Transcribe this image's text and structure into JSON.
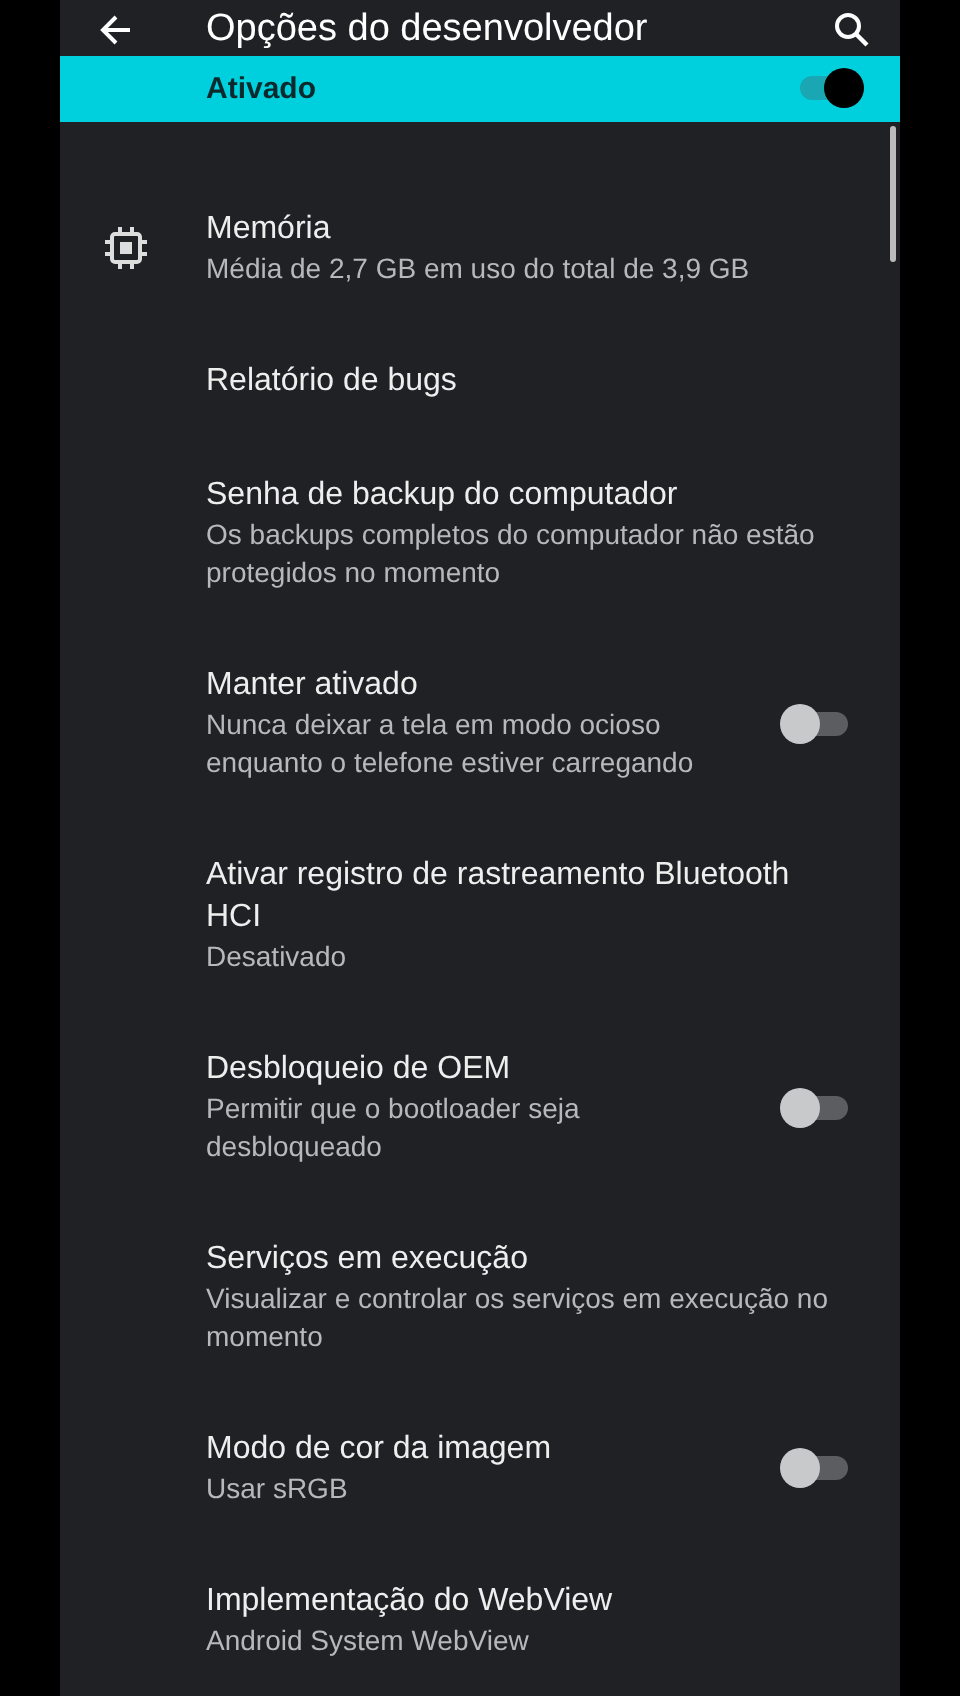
{
  "app_bar": {
    "title": "Opções do desenvolvedor"
  },
  "main_switch": {
    "label": "Ativado",
    "on": true
  },
  "settings": [
    {
      "title": "Memória",
      "summary": "Média de 2,7 GB em uso do total de 3,9 GB",
      "kind": "memory"
    },
    {
      "title": "Relatório de bugs",
      "kind": "plain"
    },
    {
      "title": "Senha de backup do computador",
      "summary": "Os backups completos do computador não estão protegidos no momento",
      "kind": "plain"
    },
    {
      "title": "Manter ativado",
      "summary": "Nunca deixar a tela em modo ocioso enquanto o telefone estiver carregando",
      "kind": "toggle",
      "on": false
    },
    {
      "title": "Ativar registro de rastreamento Bluetooth HCI",
      "summary": "Desativado",
      "kind": "plain"
    },
    {
      "title": "Desbloqueio de OEM",
      "summary": "Permitir que o bootloader seja desbloqueado",
      "kind": "toggle",
      "on": false
    },
    {
      "title": "Serviços em execução",
      "summary": "Visualizar e controlar os serviços em execução no momento",
      "kind": "plain"
    },
    {
      "title": "Modo de cor da imagem",
      "summary": "Usar sRGB",
      "kind": "toggle",
      "on": false
    },
    {
      "title": "Implementação do WebView",
      "summary": "Android System WebView",
      "kind": "plain"
    }
  ]
}
